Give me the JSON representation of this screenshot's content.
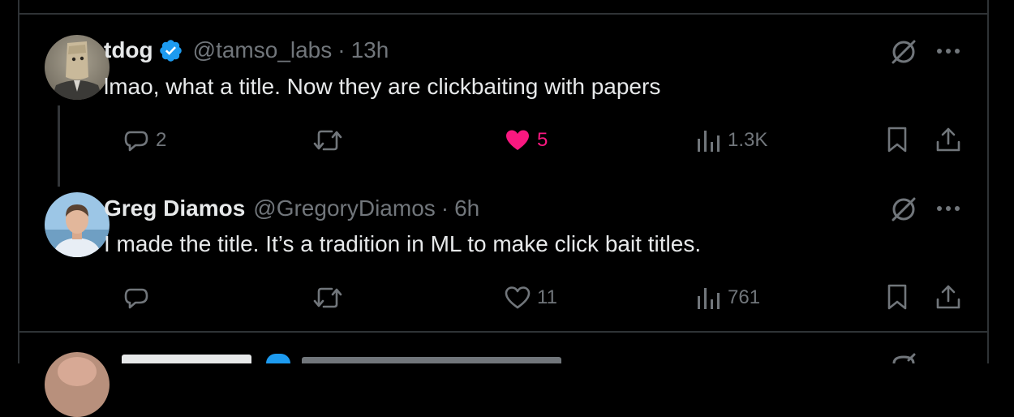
{
  "tweets": [
    {
      "name": "tdog",
      "verified": true,
      "handle": "@tamso_labs",
      "separator": "·",
      "time": "13h",
      "text": "lmao, what a title. Now they are clickbaiting with papers",
      "actions": {
        "replies": "2",
        "reposts": "",
        "likes": "5",
        "views": "1.3K"
      },
      "liked": true
    },
    {
      "name": "Greg Diamos",
      "verified": false,
      "handle": "@GregoryDiamos",
      "separator": "·",
      "time": "6h",
      "text": "I made the title. It’s a tradition in ML to make click bait titles.",
      "actions": {
        "replies": "",
        "reposts": "",
        "likes": "11",
        "views": "761"
      },
      "liked": false
    }
  ],
  "icons": {
    "reply": "reply-icon",
    "repost": "repost-icon",
    "like": "heart-icon",
    "views": "views-icon",
    "bookmark": "bookmark-icon",
    "share": "share-icon",
    "grok": "grok-icon",
    "more": "more-icon",
    "verified": "verified-badge-icon"
  },
  "colors": {
    "background": "#000000",
    "text_primary": "#e7e9ea",
    "text_secondary": "#71767b",
    "border": "#2f3336",
    "like_active": "#f91880",
    "verified_blue": "#1d9bf0"
  }
}
